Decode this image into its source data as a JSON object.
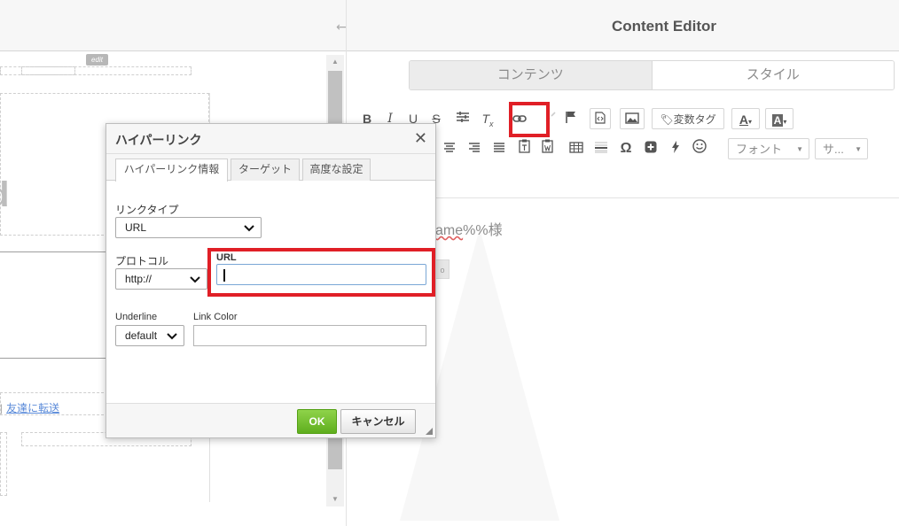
{
  "editor": {
    "title": "Content Editor",
    "tabs": [
      {
        "label": "コンテンツ",
        "active": true
      },
      {
        "label": "スタイル",
        "active": false
      }
    ],
    "toolbar": {
      "variable_tag_label": "変数タグ",
      "font_placeholder": "フォント",
      "size_placeholder": "サ..."
    },
    "body_text_prefix": "ame",
    "body_text_suffix": "%%様",
    "chip_text": "o"
  },
  "preview": {
    "edit_badge": "edit",
    "logo_glyph": "d",
    "footer_separator": "|",
    "footer_link": "友達に転送"
  },
  "dialog": {
    "title": "ハイパーリンク",
    "close_glyph": "✕",
    "tabs": [
      {
        "label": "ハイパーリンク情報",
        "active": true
      },
      {
        "label": "ターゲット",
        "active": false
      },
      {
        "label": "高度な設定",
        "active": false
      }
    ],
    "link_type": {
      "label": "リンクタイプ",
      "value": "URL"
    },
    "protocol": {
      "label": "プロトコル",
      "value": "http://"
    },
    "url": {
      "label": "URL",
      "value": ""
    },
    "underline": {
      "label": "Underline",
      "value": "default"
    },
    "link_color": {
      "label": "Link Color",
      "value": ""
    },
    "ok_label": "OK",
    "cancel_label": "キャンセル"
  },
  "colors": {
    "highlight": "#e01f26",
    "ok_green": "#6cbf2a",
    "link_blue": "#5b8bd9"
  },
  "icons": [
    "bold-icon",
    "italic-icon",
    "underline-icon",
    "strikethrough-icon",
    "format-icon",
    "remove-format-icon",
    "link-icon",
    "unlink-icon",
    "flag-icon",
    "source-icon",
    "image-icon",
    "tag-icon",
    "text-color-icon",
    "bg-color-icon",
    "align-center-icon",
    "align-right-icon",
    "justify-icon",
    "paste-text-icon",
    "paste-word-icon",
    "table-icon",
    "horizontal-rule-icon",
    "omega-icon",
    "plus-box-icon",
    "bolt-icon",
    "smiley-icon",
    "chevron-down-icon",
    "close-icon",
    "resize-grip-icon"
  ]
}
